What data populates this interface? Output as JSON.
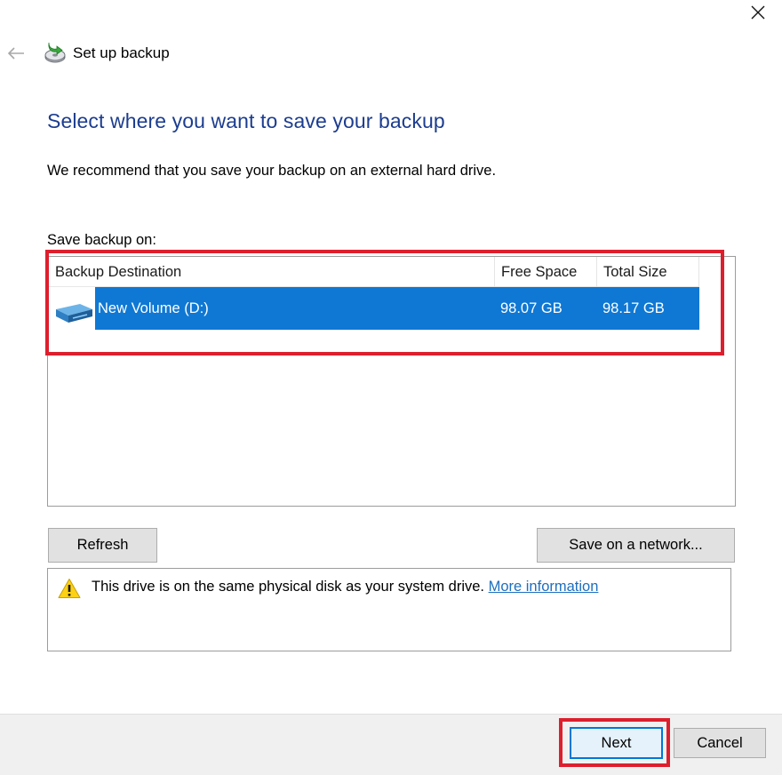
{
  "window": {
    "title": "Set up backup",
    "icon": "backup-drive-icon",
    "close_icon": "close-icon",
    "back_icon": "back-arrow-icon"
  },
  "page": {
    "heading": "Select where you want to save your backup",
    "recommendation": "We recommend that you save your backup on an external hard drive.",
    "list_label": "Save backup on:"
  },
  "table": {
    "columns": [
      "Backup Destination",
      "Free Space",
      "Total Size"
    ],
    "rows": [
      {
        "icon": "drive-icon",
        "name": "New Volume (D:)",
        "free_space": "98.07 GB",
        "total_size": "98.17 GB",
        "selected": true
      }
    ]
  },
  "buttons": {
    "refresh": "Refresh",
    "save_network": "Save on a network...",
    "next": "Next",
    "cancel": "Cancel"
  },
  "warning": {
    "icon": "warning-icon",
    "text": "This drive is on the same physical disk as your system drive.",
    "link": "More information"
  },
  "colors": {
    "heading": "#1c3d8f",
    "selection": "#0f78d4",
    "link": "#1e6fbf",
    "annotation": "#dd1f2d",
    "default_button_border": "#0078d7",
    "footer_bg": "#f0f0f0"
  }
}
